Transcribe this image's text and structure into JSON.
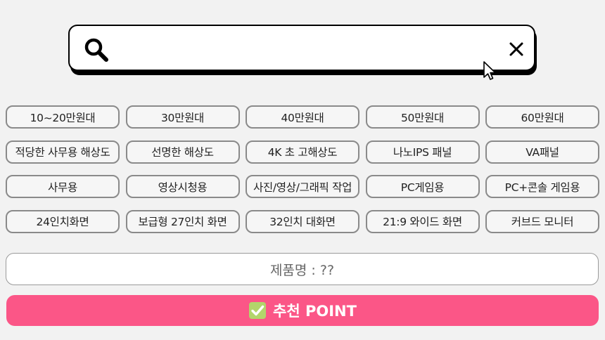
{
  "search": {
    "value": "",
    "placeholder": ""
  },
  "filters": {
    "price": [
      "10~20만원대",
      "30만원대",
      "40만원대",
      "50만원대",
      "60만원대"
    ],
    "resolution_panel": [
      "적당한 사무용 해상도",
      "선명한 해상도",
      "4K 초 고해상도",
      "나노IPS 패널",
      "VA패널"
    ],
    "usage": [
      "사무용",
      "영상시청용",
      "사진/영상/그래픽 작업",
      "PC게임용",
      "PC+콘솔 게임용"
    ],
    "screen_size": [
      "24인치화면",
      "보급형 27인치 화면",
      "32인치 대화면",
      "21:9 와이드 화면",
      "커브드 모니터"
    ]
  },
  "product": {
    "name_text": "제품명 : ??"
  },
  "recommend": {
    "label": "추천 POINT"
  },
  "colors": {
    "accent_pink": "#fb5687",
    "check_green": "#b3d56b",
    "chip_border": "#8a8a8a"
  },
  "icons": {
    "search": "search-icon",
    "clear": "close-icon",
    "pointer": "mouse-cursor-icon",
    "check": "checkmark-box-icon"
  }
}
